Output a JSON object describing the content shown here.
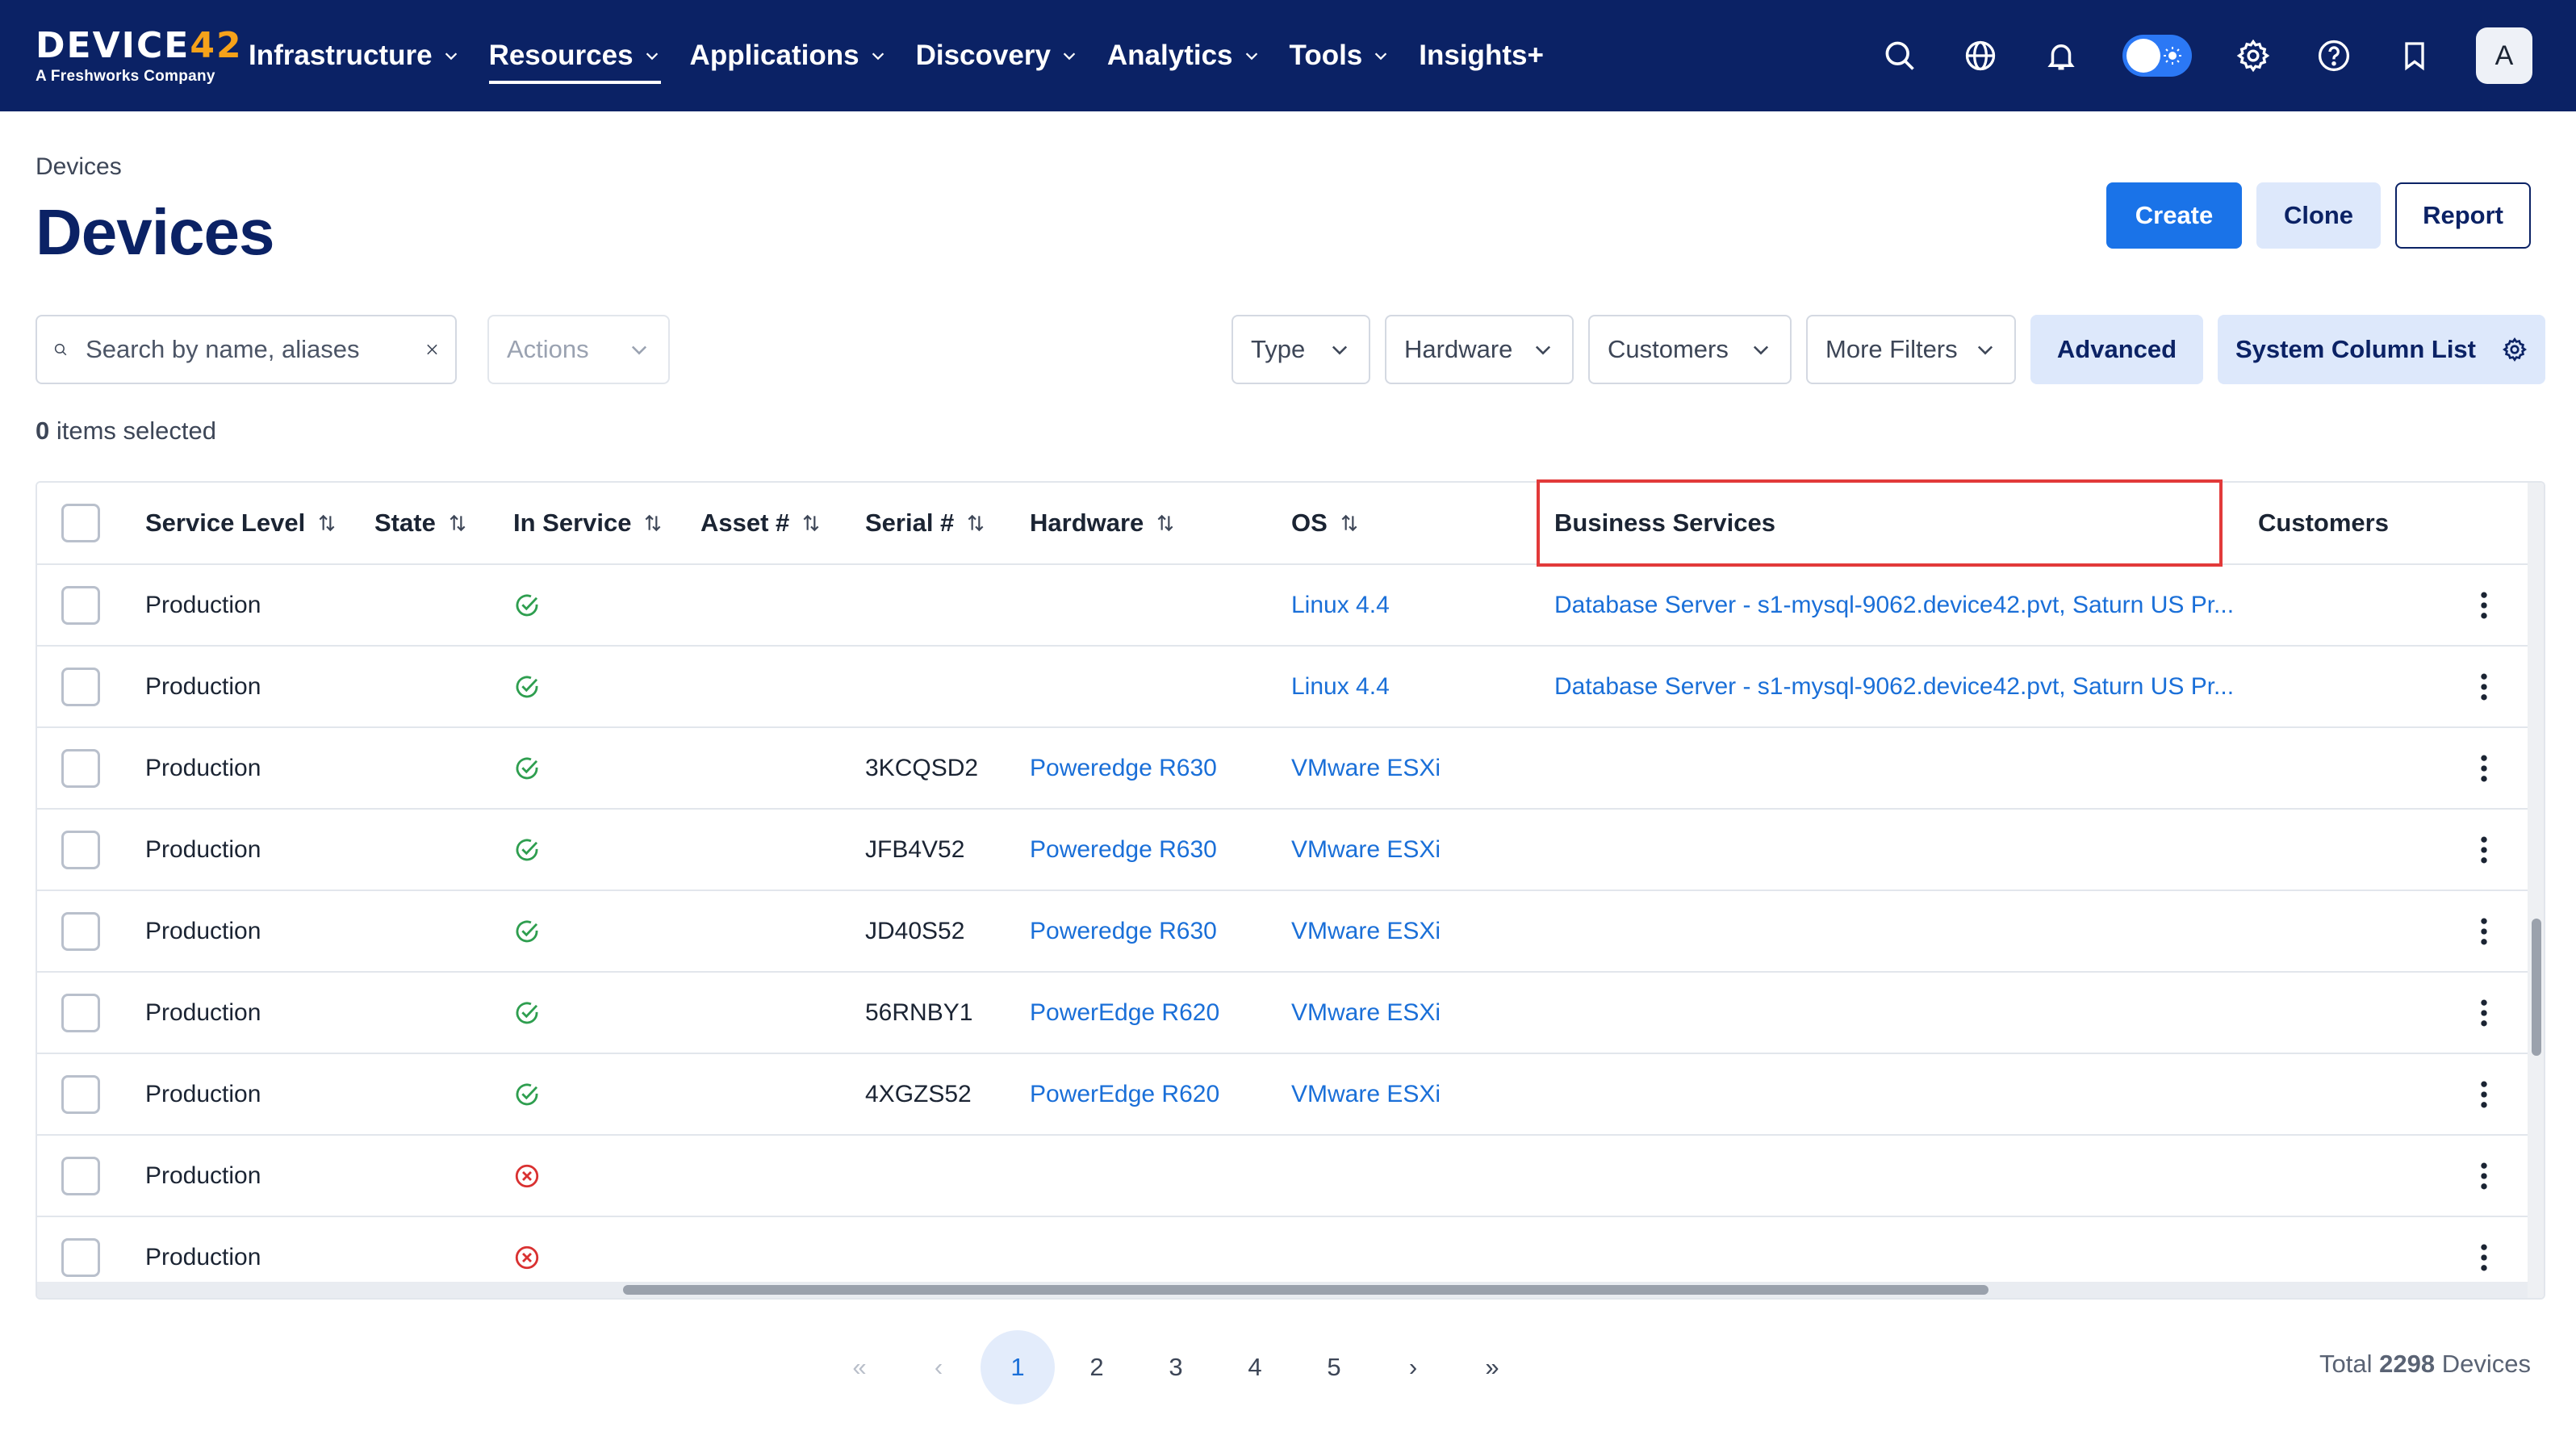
{
  "app": {
    "logo_main": "DEVICE",
    "logo_num": "42",
    "logo_sub": "A Freshworks Company"
  },
  "nav": {
    "items": [
      {
        "label": "Infrastructure",
        "dropdown": true,
        "active": false
      },
      {
        "label": "Resources",
        "dropdown": true,
        "active": true
      },
      {
        "label": "Applications",
        "dropdown": true,
        "active": false
      },
      {
        "label": "Discovery",
        "dropdown": true,
        "active": false
      },
      {
        "label": "Analytics",
        "dropdown": true,
        "active": false
      },
      {
        "label": "Tools",
        "dropdown": true,
        "active": false
      },
      {
        "label": "Insights+",
        "dropdown": false,
        "active": false
      }
    ],
    "right_icons": [
      "search-icon",
      "globe-icon",
      "bell-icon",
      "theme-toggle",
      "gear-icon",
      "help-icon",
      "bookmark-icon"
    ],
    "avatar_initial": "A"
  },
  "header": {
    "breadcrumb": "Devices",
    "title": "Devices",
    "buttons": {
      "create": "Create",
      "clone": "Clone",
      "report": "Report"
    }
  },
  "filters": {
    "search_placeholder": "Search by name, aliases",
    "actions_label": "Actions",
    "type_label": "Type",
    "hardware_label": "Hardware",
    "customers_label": "Customers",
    "more_filters_label": "More Filters",
    "advanced_label": "Advanced",
    "system_column_list_label": "System Column List"
  },
  "selection": {
    "count": "0",
    "suffix": " items selected"
  },
  "table": {
    "columns": [
      {
        "label": "Service Level",
        "sortable": true
      },
      {
        "label": "State",
        "sortable": true
      },
      {
        "label": "In Service",
        "sortable": true
      },
      {
        "label": "Asset #",
        "sortable": true
      },
      {
        "label": "Serial #",
        "sortable": true
      },
      {
        "label": "Hardware",
        "sortable": true
      },
      {
        "label": "OS",
        "sortable": true
      },
      {
        "label": "Business Services",
        "sortable": false
      },
      {
        "label": "Customers",
        "sortable": false
      }
    ],
    "rows": [
      {
        "service_level": "Production",
        "state": "",
        "in_service": "yes",
        "asset": "",
        "serial": "",
        "hardware": "",
        "os": "Linux 4.4",
        "business_services": "Database Server - s1-mysql-9062.device42.pvt, Saturn US Pr...",
        "customers": ""
      },
      {
        "service_level": "Production",
        "state": "",
        "in_service": "yes",
        "asset": "",
        "serial": "",
        "hardware": "",
        "os": "Linux 4.4",
        "business_services": "Database Server - s1-mysql-9062.device42.pvt, Saturn US Pr...",
        "customers": ""
      },
      {
        "service_level": "Production",
        "state": "",
        "in_service": "yes",
        "asset": "",
        "serial": "3KCQSD2",
        "hardware": "Poweredge R630",
        "os": "VMware ESXi",
        "business_services": "",
        "customers": ""
      },
      {
        "service_level": "Production",
        "state": "",
        "in_service": "yes",
        "asset": "",
        "serial": "JFB4V52",
        "hardware": "Poweredge R630",
        "os": "VMware ESXi",
        "business_services": "",
        "customers": ""
      },
      {
        "service_level": "Production",
        "state": "",
        "in_service": "yes",
        "asset": "",
        "serial": "JD40S52",
        "hardware": "Poweredge R630",
        "os": "VMware ESXi",
        "business_services": "",
        "customers": ""
      },
      {
        "service_level": "Production",
        "state": "",
        "in_service": "yes",
        "asset": "",
        "serial": "56RNBY1",
        "hardware": "PowerEdge R620",
        "os": "VMware ESXi",
        "business_services": "",
        "customers": ""
      },
      {
        "service_level": "Production",
        "state": "",
        "in_service": "yes",
        "asset": "",
        "serial": "4XGZS52",
        "hardware": "PowerEdge R620",
        "os": "VMware ESXi",
        "business_services": "",
        "customers": ""
      },
      {
        "service_level": "Production",
        "state": "",
        "in_service": "no",
        "asset": "",
        "serial": "",
        "hardware": "",
        "os": "",
        "business_services": "",
        "customers": ""
      },
      {
        "service_level": "Production",
        "state": "",
        "in_service": "no",
        "asset": "",
        "serial": "",
        "hardware": "",
        "os": "",
        "business_services": "",
        "customers": ""
      }
    ]
  },
  "pagination": {
    "first": "«",
    "prev": "‹",
    "pages": [
      "1",
      "2",
      "3",
      "4",
      "5"
    ],
    "current": "1",
    "next": "›",
    "last": "»",
    "total_prefix": "Total ",
    "total_count": "2298",
    "total_suffix": " Devices"
  },
  "colors": {
    "nav_bg": "#0b2265",
    "accent": "#1a73e8",
    "link": "#1a6fd8",
    "success": "#2e9e4f",
    "error": "#d93131",
    "highlight": "#e23a3a"
  }
}
